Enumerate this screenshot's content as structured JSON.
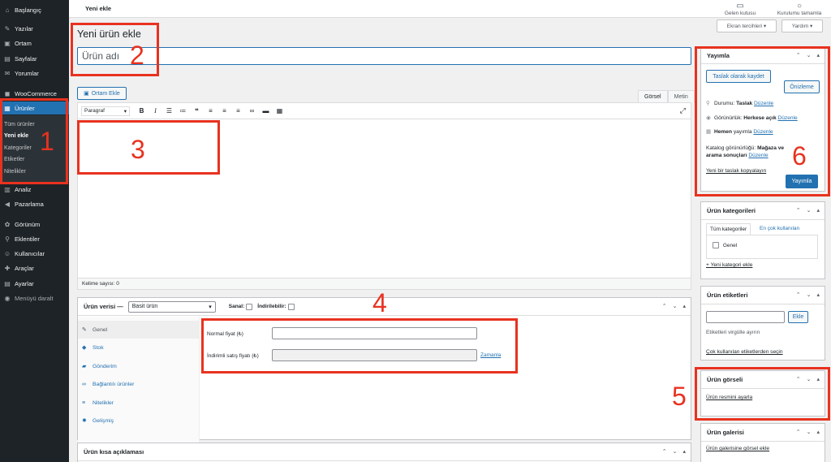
{
  "sidebar": {
    "items": [
      {
        "label": "Başlangıç",
        "icon": "dashboard-icon",
        "glyph": "⌂"
      },
      {
        "label": "Yazılar",
        "icon": "pin-icon",
        "glyph": "✎"
      },
      {
        "label": "Ortam",
        "icon": "media-icon",
        "glyph": "▣"
      },
      {
        "label": "Sayfalar",
        "icon": "pages-icon",
        "glyph": "▤"
      },
      {
        "label": "Yorumlar",
        "icon": "comments-icon",
        "glyph": "✉"
      },
      {
        "label": "WooCommerce",
        "icon": "woocommerce-icon",
        "glyph": "◼"
      },
      {
        "label": "Ürünler",
        "icon": "products-icon",
        "glyph": "▦"
      }
    ],
    "products_submenu": [
      {
        "label": "Tüm ürünler"
      },
      {
        "label": "Yeni ekle"
      },
      {
        "label": "Kategoriler"
      },
      {
        "label": "Etiketler"
      },
      {
        "label": "Nitelikler"
      }
    ],
    "items_after": [
      {
        "label": "Analiz",
        "icon": "analytics-icon",
        "glyph": "▥"
      },
      {
        "label": "Pazarlama",
        "icon": "megaphone-icon",
        "glyph": "◀"
      },
      {
        "label": "Görünüm",
        "icon": "appearance-icon",
        "glyph": "✿"
      },
      {
        "label": "Eklentiler",
        "icon": "plugins-icon",
        "glyph": "⚲"
      },
      {
        "label": "Kullanıcılar",
        "icon": "users-icon",
        "glyph": "☺"
      },
      {
        "label": "Araçlar",
        "icon": "tools-icon",
        "glyph": "✚"
      },
      {
        "label": "Ayarlar",
        "icon": "settings-icon",
        "glyph": "▤"
      },
      {
        "label": "Menüyü daralt",
        "icon": "collapse-icon",
        "glyph": "◉"
      }
    ]
  },
  "topbar": {
    "breadcrumb": "Yeni ekle",
    "inbox_label": "Gelen kutusu",
    "setup_label": "Kurulumu tamamla",
    "screen_options": "Ekran tercihleri ▾",
    "help": "Yardım ▾"
  },
  "main": {
    "heading": "Yeni ürün ekle",
    "title_placeholder": "Ürün adı",
    "add_media": "Ortam Ekle",
    "editor_tabs": [
      "Görsel",
      "Metin"
    ],
    "format_select": "Paragraf",
    "word_count": "Kelime sayısı: 0"
  },
  "product_data": {
    "title": "Ürün verisi —",
    "type_select": "Basit ürün",
    "virtual_label": "Sanal:",
    "downloadable_label": "İndirilebilir:",
    "tabs": [
      {
        "label": "Genel",
        "icon": "wrench-icon",
        "glyph": "✎"
      },
      {
        "label": "Stok",
        "icon": "tag-icon",
        "glyph": "◆"
      },
      {
        "label": "Gönderim",
        "icon": "truck-icon",
        "glyph": "▰"
      },
      {
        "label": "Bağlantılı ürünler",
        "icon": "link-icon",
        "glyph": "∞"
      },
      {
        "label": "Nitelikler",
        "icon": "list-icon",
        "glyph": "≡"
      },
      {
        "label": "Gelişmiş",
        "icon": "gear-icon",
        "glyph": "✹"
      }
    ],
    "regular_price_label": "Normal fiyat (₺)",
    "sale_price_label": "İndirimli satış fiyatı (₺)",
    "schedule_link": "Zamanla"
  },
  "short_description": {
    "title": "Ürün kısa açıklaması"
  },
  "publish": {
    "title": "Yayımla",
    "save_draft": "Taslak olarak kaydet",
    "preview": "Önizleme",
    "status_label": "Durumu:",
    "status_value": "Taslak",
    "visibility_label": "Görünürlük:",
    "visibility_value": "Herkese açık",
    "publish_time_label": "Hemen",
    "publish_time_suffix": "yayımla",
    "catalog_label": "Katalog görünürlüğü:",
    "catalog_value": "Mağaza ve arama sonuçları",
    "edit_link": "Düzenle",
    "copy_draft": "Yeni bir taslak kopyalayın",
    "publish_button": "Yayımla"
  },
  "categories": {
    "title": "Ürün kategorileri",
    "tab_all": "Tüm kategoriler",
    "tab_popular": "En çok kullanılan",
    "item": "Genel",
    "add_link": "+ Yeni kategori ekle"
  },
  "tags": {
    "title": "Ürün etiketleri",
    "add_button": "Ekle",
    "hint": "Etiketleri virgülle ayırın",
    "popular_link": "Çok kullanılan etiketlerden seçin"
  },
  "image": {
    "title": "Ürün görseli",
    "set_link": "Ürün resmini ayarla"
  },
  "gallery": {
    "title": "Ürün galerisi",
    "add_link": "Ürün galerisine görsel ekle"
  },
  "annotations": [
    "1",
    "2",
    "3",
    "4",
    "5",
    "6"
  ],
  "colors": {
    "accent": "#2271b1",
    "annotation": "#e8321f",
    "sidebar": "#1d2327"
  }
}
